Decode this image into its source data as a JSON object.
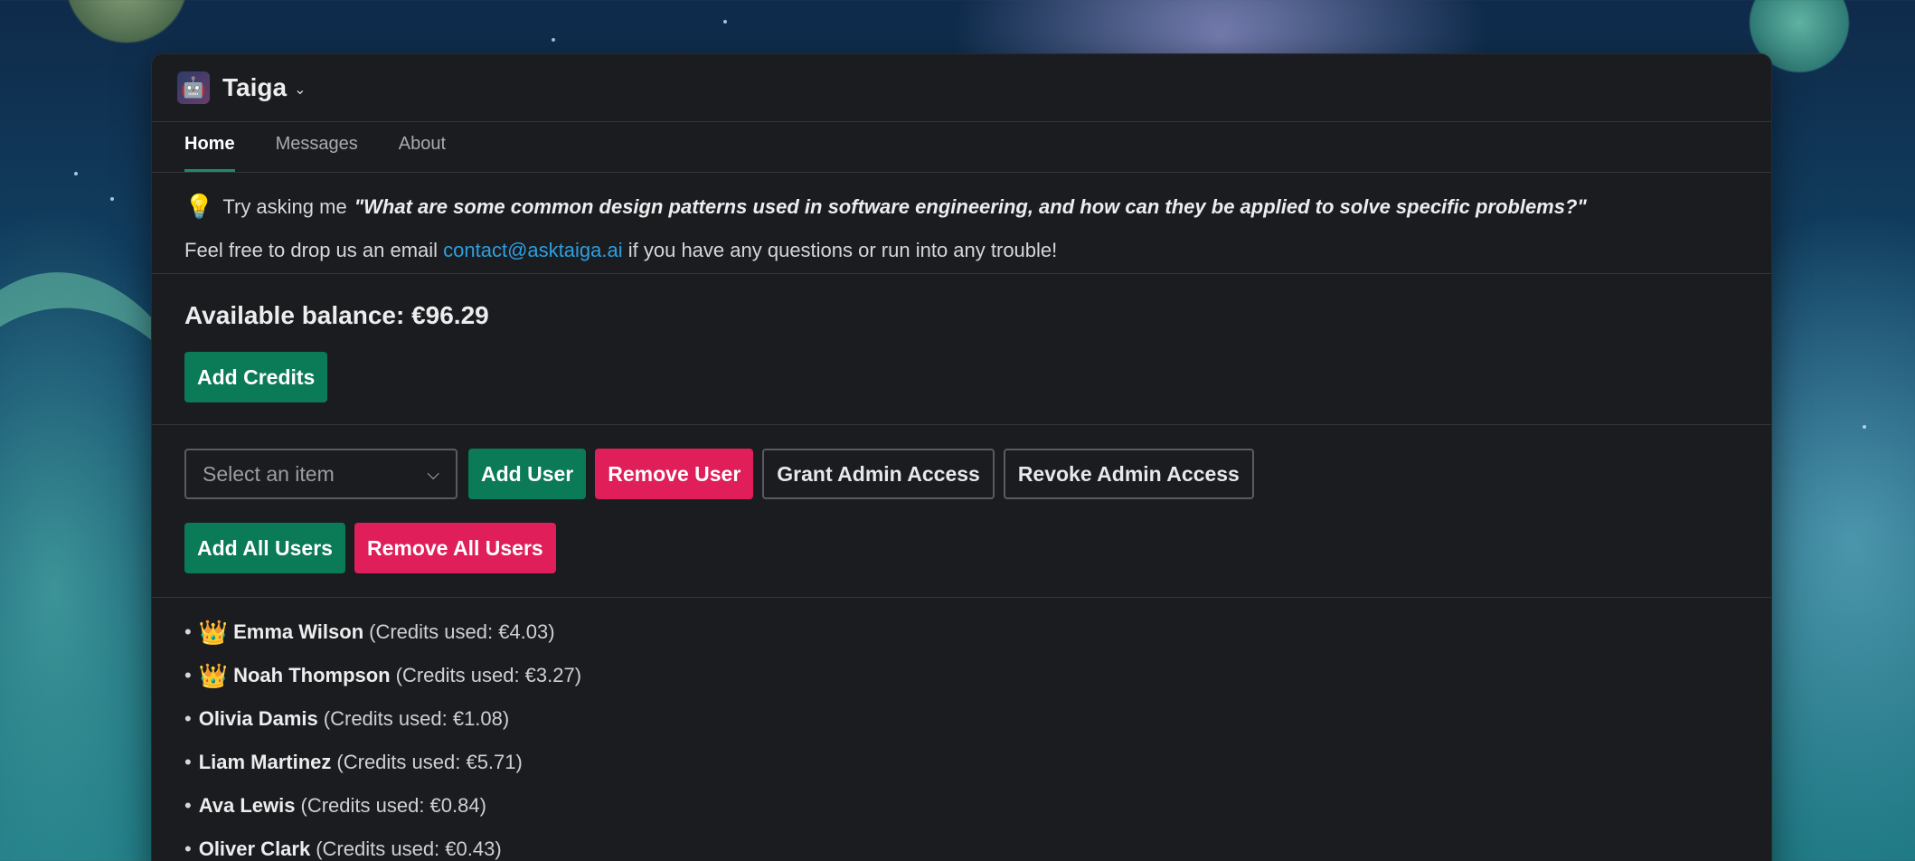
{
  "app": {
    "title": "Taiga",
    "icon": "robot-avatar-icon"
  },
  "tabs": [
    {
      "label": "Home",
      "active": true
    },
    {
      "label": "Messages",
      "active": false
    },
    {
      "label": "About",
      "active": false
    }
  ],
  "hint": {
    "prefix": "Try asking me",
    "quote": "\"What are some common design patterns used in software engineering, and how can they be applied to solve specific problems?\""
  },
  "contact": {
    "prefix": "Feel free to drop us an email",
    "email": "contact@asktaiga.ai",
    "suffix": "if you have any questions or run into any trouble!"
  },
  "balance": {
    "label": "Available balance: €96.29"
  },
  "buttons": {
    "add_credits": "Add Credits",
    "add_user": "Add User",
    "remove_user": "Remove User",
    "grant_admin": "Grant Admin Access",
    "revoke_admin": "Revoke Admin Access",
    "add_all": "Add All Users",
    "remove_all": "Remove All Users"
  },
  "select": {
    "placeholder": "Select an item"
  },
  "users": [
    {
      "name": "Emma Wilson",
      "credits": "(Credits used: €4.03)",
      "admin": true
    },
    {
      "name": "Noah Thompson",
      "credits": "(Credits used: €3.27)",
      "admin": true
    },
    {
      "name": "Olivia Damis",
      "credits": "(Credits used: €1.08)",
      "admin": false
    },
    {
      "name": "Liam Martinez",
      "credits": "(Credits used: €5.71)",
      "admin": false
    },
    {
      "name": "Ava Lewis",
      "credits": "(Credits used: €0.84)",
      "admin": false
    },
    {
      "name": "Oliver Clark",
      "credits": "(Credits used: €0.43)",
      "admin": false
    }
  ],
  "colors": {
    "accent_green": "#0b7a56",
    "accent_pink": "#e01e5a",
    "link_blue": "#2d9fdf",
    "window_bg": "#1b1c20"
  }
}
